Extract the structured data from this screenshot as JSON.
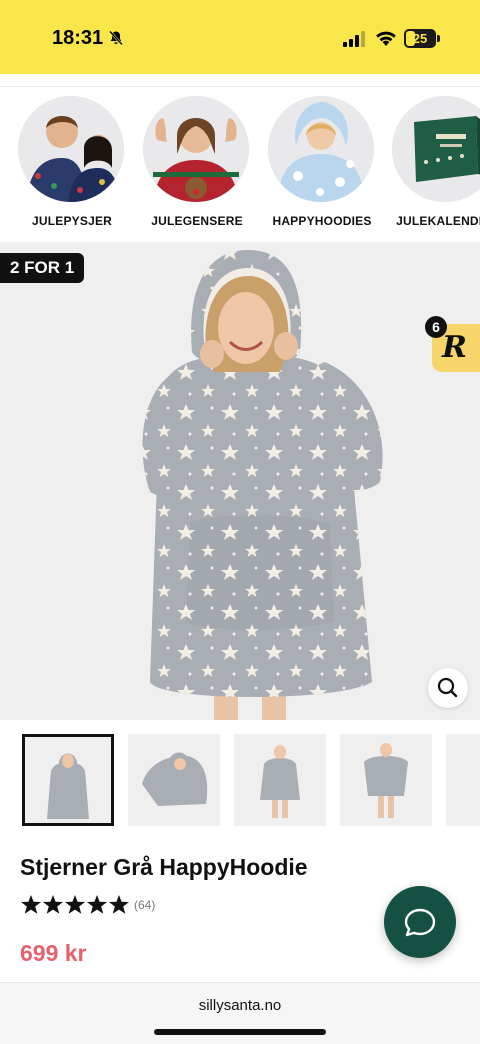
{
  "status_bar": {
    "time": "18:31",
    "battery": "25",
    "bg_color": "#f9e64a",
    "icons": [
      "bell-slash-icon",
      "cellular-signal-icon",
      "wifi-icon",
      "battery-icon"
    ]
  },
  "categories": [
    {
      "label": "JULEPYSJER"
    },
    {
      "label": "JULEGENSERE"
    },
    {
      "label": "HAPPYHOODIES"
    },
    {
      "label": "JULEKALENDER"
    }
  ],
  "gallery": {
    "promo_badge": "2 FOR 1",
    "reward_count": "6",
    "reward_glyph": "R",
    "thumbnail_count": 5,
    "active_thumbnail": 1
  },
  "product": {
    "title": "Stjerner Grå HappyHoodie",
    "rating": 5,
    "review_count": "(64)",
    "price": "699 kr",
    "price_color": "#e5626b"
  },
  "chat": {
    "color": "#145143",
    "icon": "chat-bubble-icon"
  },
  "browser": {
    "domain": "sillysanta.no"
  }
}
